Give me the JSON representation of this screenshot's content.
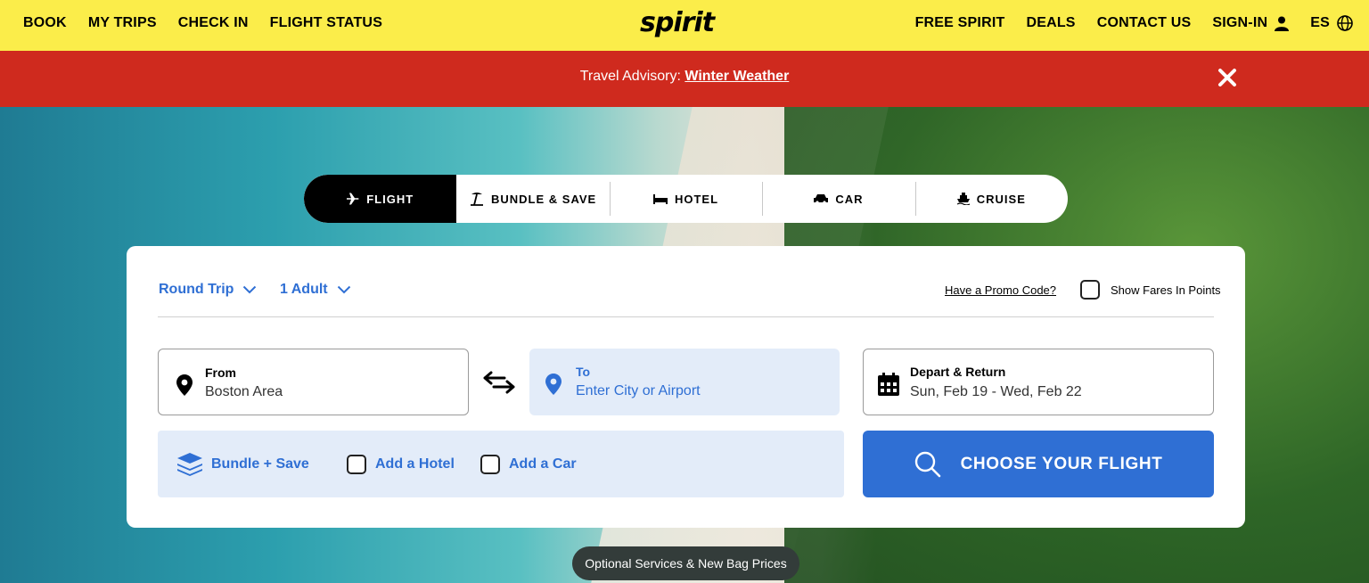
{
  "nav": {
    "left": [
      "BOOK",
      "MY TRIPS",
      "CHECK IN",
      "FLIGHT STATUS"
    ],
    "logo": "spirit",
    "right": [
      "FREE SPIRIT",
      "DEALS",
      "CONTACT US"
    ],
    "signin": "SIGN-IN",
    "language": "ES",
    "icons": {
      "account": "user-icon",
      "language": "globe-icon"
    }
  },
  "advisory": {
    "prefix": "Travel Advisory: ",
    "link": "Winter Weather",
    "close_icon": "close-icon"
  },
  "tabs": [
    {
      "label": "FLIGHT",
      "icon": "plane-icon",
      "active": true
    },
    {
      "label": "BUNDLE & SAVE",
      "icon": "beach-icon",
      "active": false
    },
    {
      "label": "HOTEL",
      "icon": "bed-icon",
      "active": false
    },
    {
      "label": "CAR",
      "icon": "car-icon",
      "active": false
    },
    {
      "label": "CRUISE",
      "icon": "ship-icon",
      "active": false
    }
  ],
  "booking": {
    "trip_type": "Round Trip",
    "passengers": "1 Adult",
    "promo": "Have a Promo Code?",
    "show_points": "Show Fares In Points",
    "from": {
      "label": "From",
      "value": "Boston Area"
    },
    "to": {
      "label": "To",
      "placeholder": "Enter City or Airport"
    },
    "dates": {
      "label": "Depart & Return",
      "value": "Sun, Feb 19 - Wed, Feb 22"
    },
    "bundle": {
      "label": "Bundle + Save",
      "add_hotel": "Add a Hotel",
      "add_car": "Add a Car"
    },
    "search_button": "CHOOSE YOUR FLIGHT"
  },
  "promo_pill": "Optional Services & New Bag Prices",
  "colors": {
    "brand_yellow": "#fbed4a",
    "advisory_red": "#cf2a1e",
    "accent_blue": "#2f6fd4",
    "field_blue": "#e3ecf9"
  }
}
